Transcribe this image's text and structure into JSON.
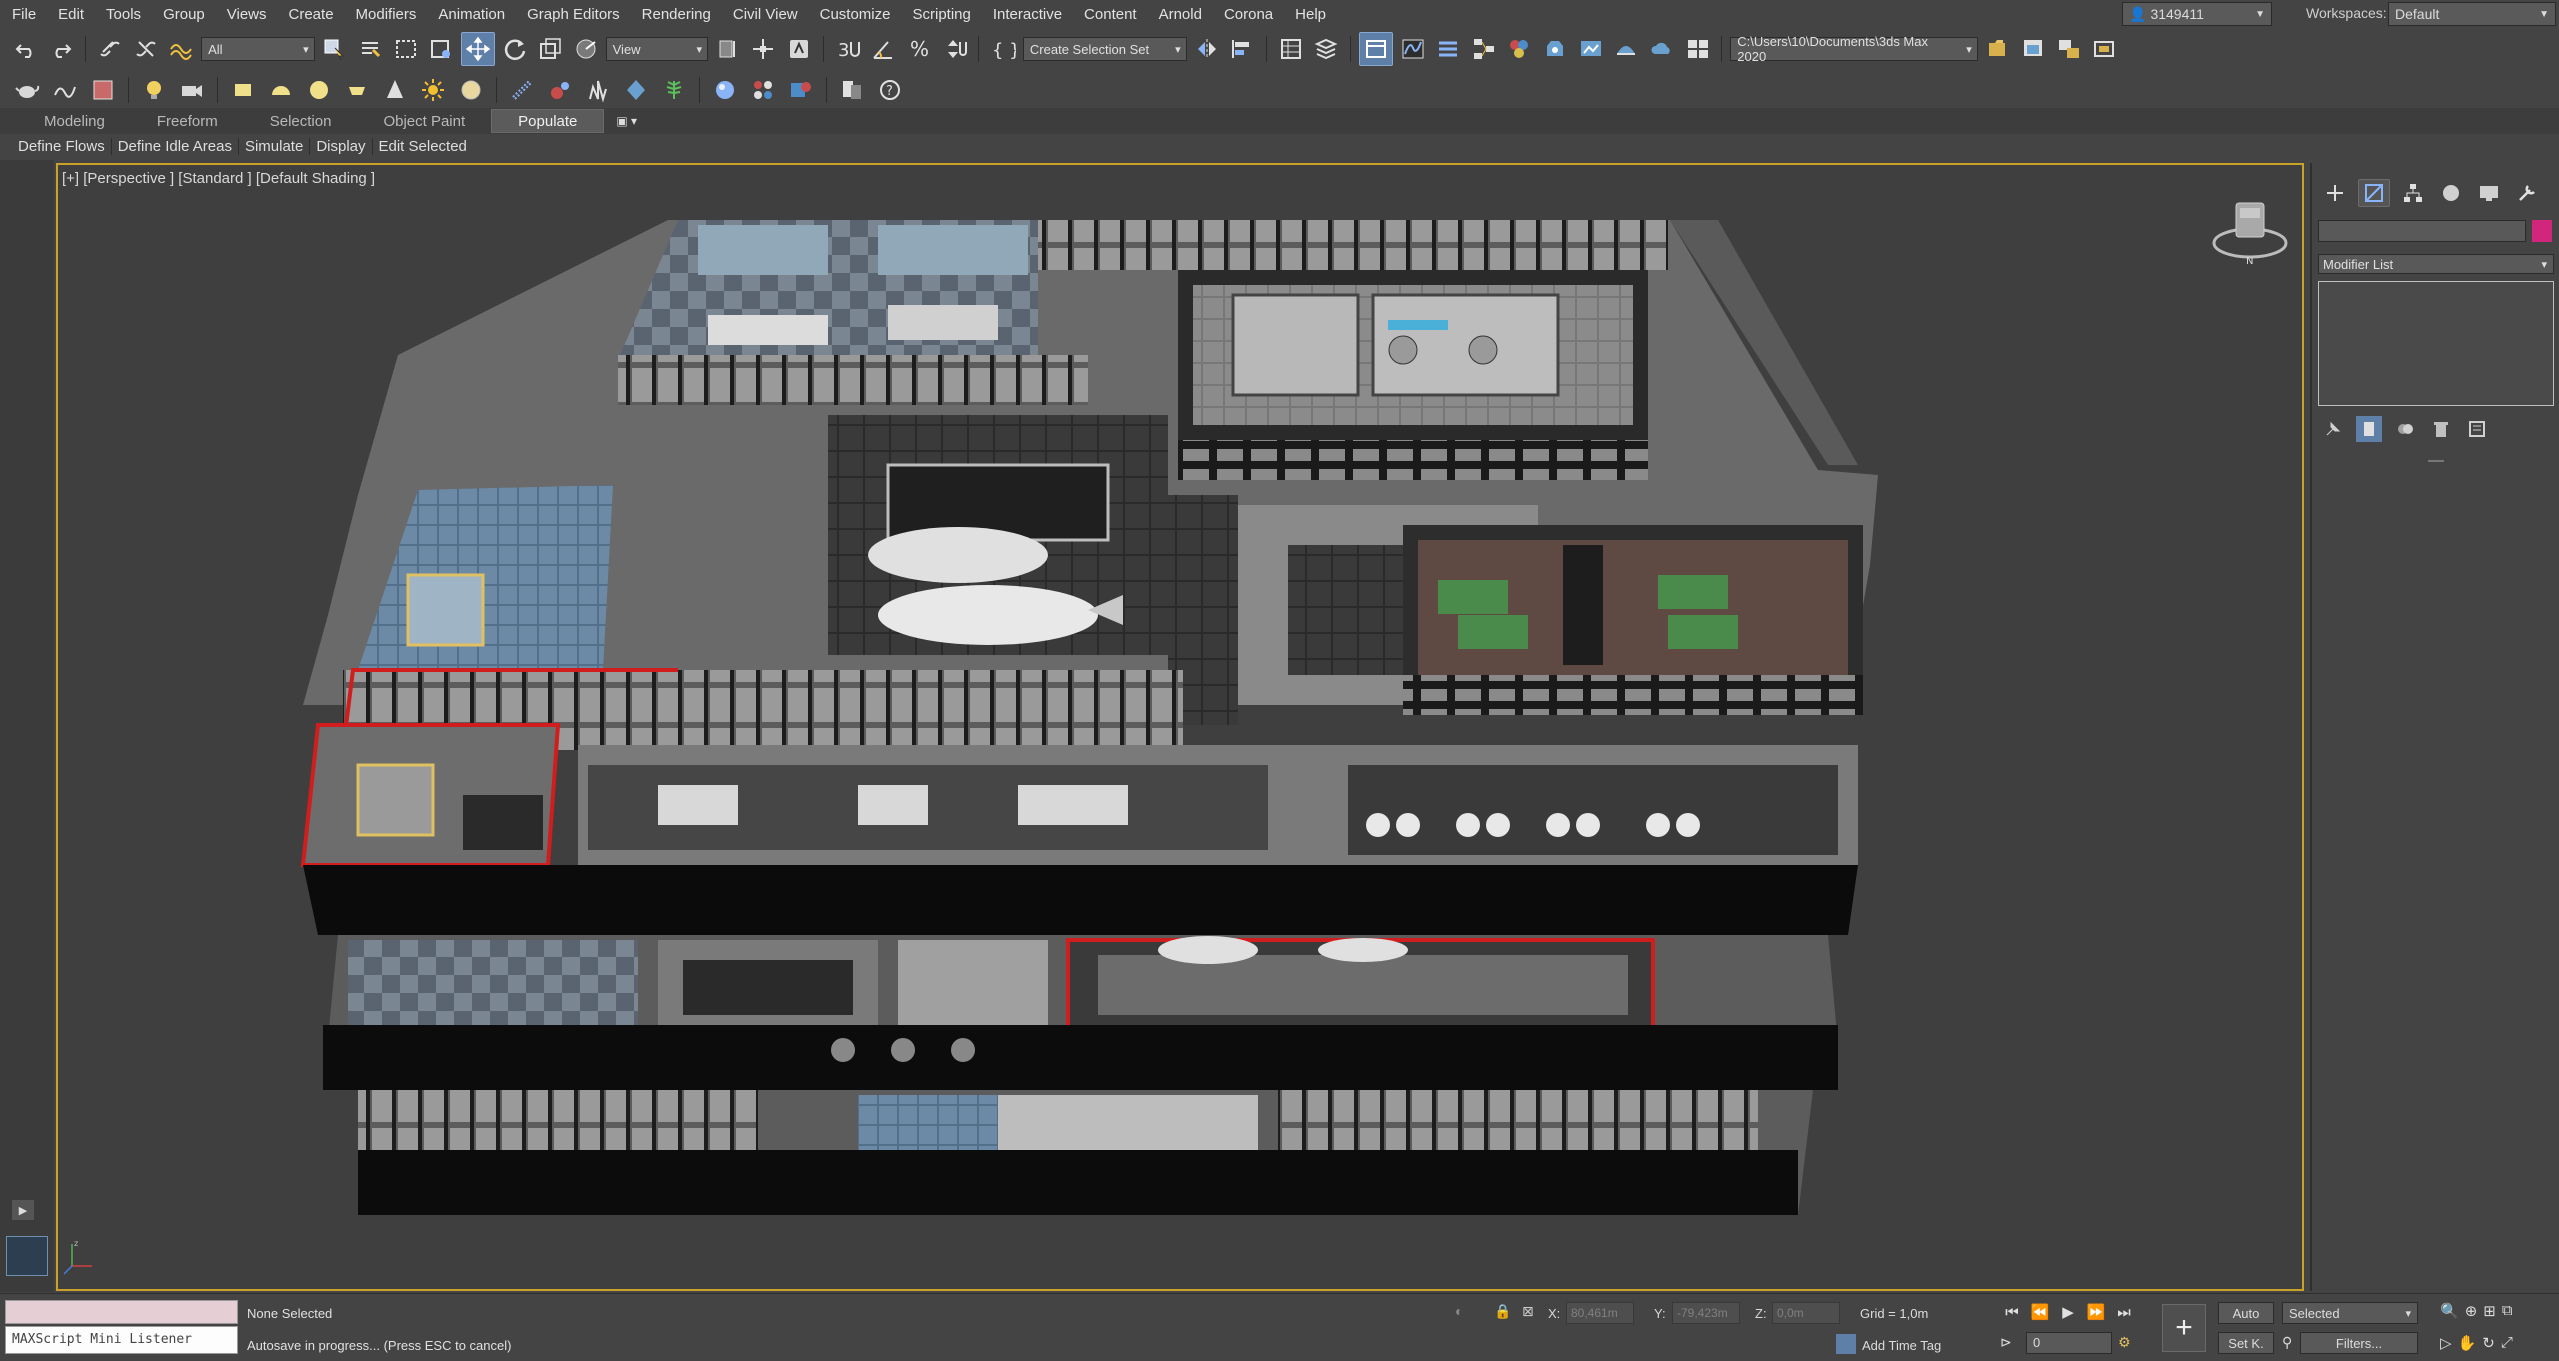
{
  "menu": [
    "File",
    "Edit",
    "Tools",
    "Group",
    "Views",
    "Create",
    "Modifiers",
    "Animation",
    "Graph Editors",
    "Rendering",
    "Civil View",
    "Customize",
    "Scripting",
    "Interactive",
    "Content",
    "Arnold",
    "Corona",
    "Help"
  ],
  "account": {
    "user": "3149411",
    "workspaces_label": "Workspaces:",
    "workspace": "Default"
  },
  "toolbar": {
    "filter": "All",
    "ref_coord": "View",
    "selection_set": "Create Selection Set",
    "project_path": "C:\\Users\\10\\Documents\\3ds Max 2020"
  },
  "ribbon": {
    "tabs": [
      "Modeling",
      "Freeform",
      "Selection",
      "Object Paint",
      "Populate"
    ],
    "active_tab": "Populate",
    "sub": [
      "Define Flows",
      "Define Idle Areas",
      "Simulate",
      "Display",
      "Edit Selected"
    ]
  },
  "viewport": {
    "label": "[+] [Perspective ] [Standard ] [Default Shading ]",
    "compass": "N"
  },
  "command_panel": {
    "modifier_list": "Modifier List",
    "swatch_color": "#d1267c"
  },
  "status": {
    "maxscript": "MAXScript Mini Listener",
    "selection": "None Selected",
    "message": "Autosave in progress... (Press ESC to cancel)",
    "x_label": "X:",
    "x_value": "80,461m",
    "y_label": "Y:",
    "y_value": "-79,423m",
    "z_label": "Z:",
    "z_value": "0,0m",
    "grid": "Grid = 1,0m",
    "add_time_tag": "Add Time Tag",
    "frame": "0",
    "auto_key": "Auto",
    "set_key": "Set K.",
    "key_filter": "Selected",
    "filters": "Filters..."
  },
  "colors": {
    "accent": "#5e7fa8",
    "viewport_border": "#c9a227",
    "highlight_red": "#d11d1d"
  }
}
